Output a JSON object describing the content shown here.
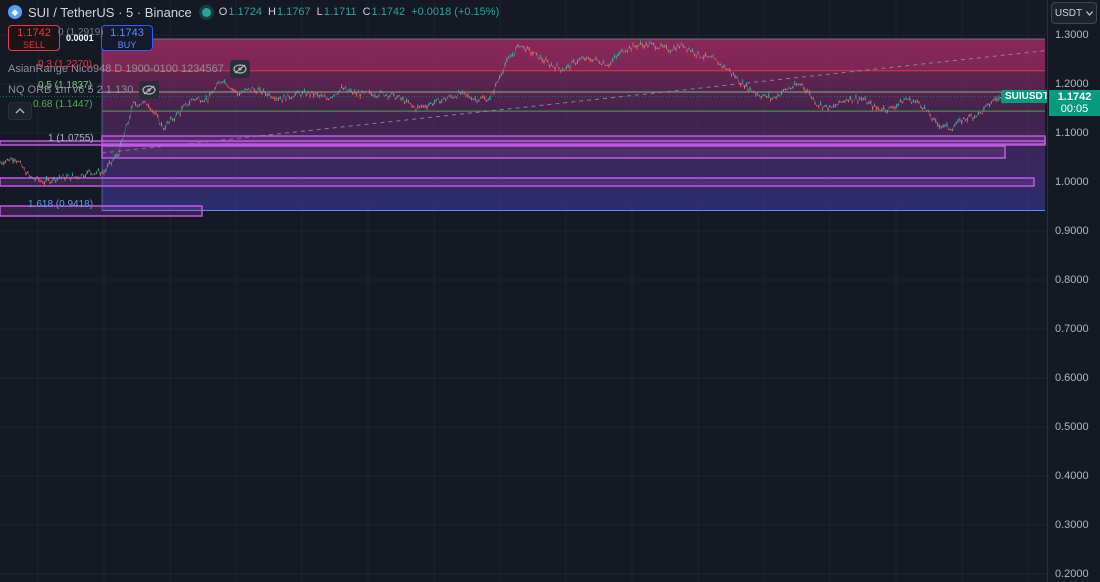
{
  "header": {
    "symbol": "SUI",
    "pair_text": "SUI / TetherUS · 5 · Binance",
    "ohlc": {
      "o_key": "O",
      "o": "1.1724",
      "h_key": "H",
      "h": "1.1767",
      "l_key": "L",
      "l": "1.1711",
      "c_key": "C",
      "c": "1.1742",
      "change": "+0.0018 (+0.15%)"
    }
  },
  "trade": {
    "sell_price": "1.1742",
    "sell_label": "SELL",
    "spread": "0.0001",
    "buy_price": "1.1743",
    "buy_label": "BUY"
  },
  "indicators": [
    {
      "name": "AsianRange Nico948 D 1900-0100 1234567"
    },
    {
      "name": "NQ ORB 1m v6 5 2 1.130"
    }
  ],
  "fib_levels": [
    {
      "label": "0 (1.2919)",
      "price": 1.2919,
      "color": "#787b86"
    },
    {
      "label": "0.3 (1.2270)",
      "price": 1.227,
      "color": "#f23645"
    },
    {
      "label": "0.5 (1.1837)",
      "price": 1.1837,
      "color": "#81c784"
    },
    {
      "label": "0.68 (1.1447)",
      "price": 1.1447,
      "color": "#4caf50"
    },
    {
      "label": "1 (1.0755)",
      "price": 1.0755,
      "color": "#b2b5be"
    },
    {
      "label": "1.618 (0.9418)",
      "price": 0.9418,
      "color": "#5b9cf6"
    }
  ],
  "price_axis": {
    "currency": "USDT",
    "ticks": [
      "1.3000",
      "1.2000",
      "1.1000",
      "1.0000",
      "0.9000",
      "0.8000",
      "0.7000",
      "0.6000",
      "0.5000",
      "0.4000",
      "0.3000",
      "0.2000"
    ],
    "tick_values": [
      1.3,
      1.2,
      1.1,
      1.0,
      0.9,
      0.8,
      0.7,
      0.6,
      0.5,
      0.4,
      0.3,
      0.2
    ],
    "last_price": "1.1742",
    "countdown": "00:05",
    "symbol_badge": "SUIUSDT"
  },
  "colors": {
    "up": "#26a69a",
    "down": "#ef5350",
    "background": "#151924",
    "grid": "#1f2330",
    "fib_zone_top": "#8a2a5c",
    "fib_zone_bottom": "#4a3a9a",
    "box": "#b04fd0"
  },
  "chart_data": {
    "type": "line",
    "series": [
      {
        "name": "SUIUSDT",
        "values": [
          1.04,
          1.05,
          1.01,
          1.0,
          1.01,
          1.01,
          1.02,
          1.02,
          1.06,
          1.16,
          1.16,
          1.11,
          1.14,
          1.17,
          1.17,
          1.21,
          1.18,
          1.19,
          1.18,
          1.17,
          1.18,
          1.18,
          1.17,
          1.19,
          1.18,
          1.18,
          1.18,
          1.17,
          1.15,
          1.16,
          1.17,
          1.18,
          1.17,
          1.17,
          1.24,
          1.28,
          1.26,
          1.24,
          1.23,
          1.25,
          1.25,
          1.24,
          1.27,
          1.28,
          1.28,
          1.27,
          1.28,
          1.26,
          1.25,
          1.23,
          1.2,
          1.18,
          1.17,
          1.19,
          1.2,
          1.16,
          1.15,
          1.17,
          1.17,
          1.15,
          1.15,
          1.17,
          1.16,
          1.12,
          1.11,
          1.13,
          1.14,
          1.17,
          1.17
        ]
      }
    ],
    "ylim": [
      0.2,
      1.3
    ]
  }
}
